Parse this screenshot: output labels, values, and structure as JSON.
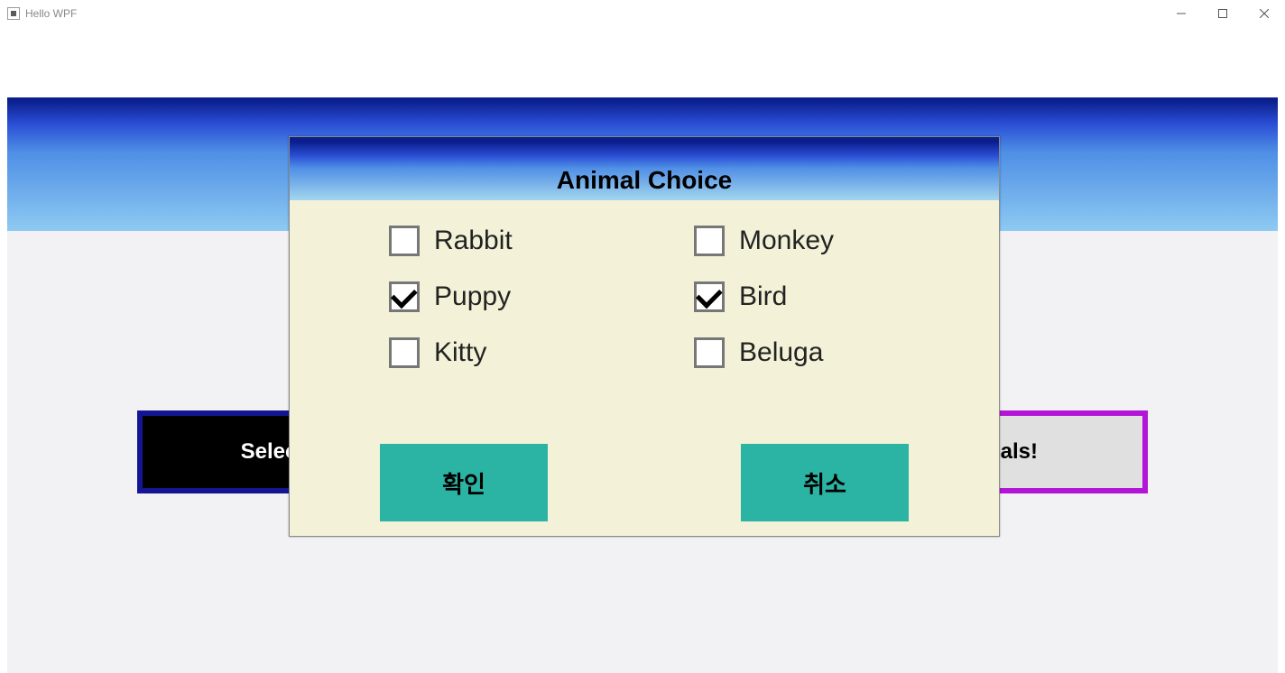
{
  "window": {
    "title": "Hello WPF"
  },
  "background": {
    "left_button": "Select",
    "right_button": "nals!"
  },
  "modal": {
    "title": "Animal Choice",
    "options": [
      {
        "label": "Rabbit",
        "checked": false
      },
      {
        "label": "Puppy",
        "checked": true
      },
      {
        "label": "Kitty",
        "checked": false
      },
      {
        "label": "Monkey",
        "checked": false
      },
      {
        "label": "Bird",
        "checked": true
      },
      {
        "label": "Beluga",
        "checked": false
      }
    ],
    "confirm_label": "확인",
    "cancel_label": "취소"
  }
}
